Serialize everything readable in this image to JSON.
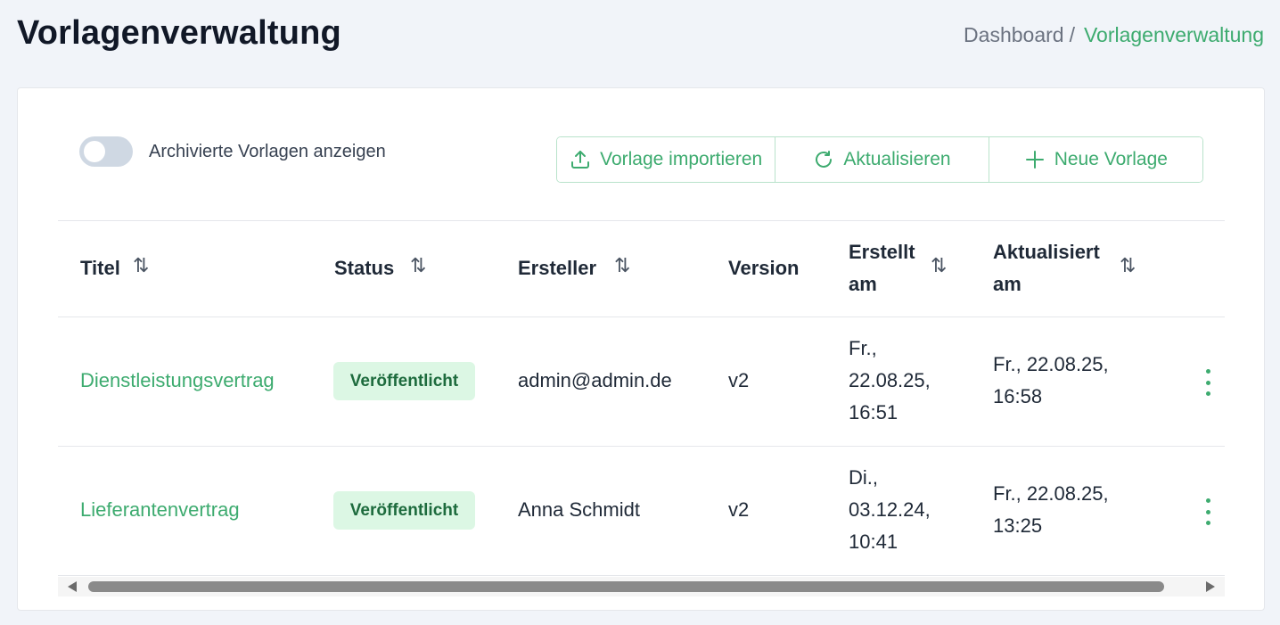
{
  "header": {
    "title": "Vorlagenverwaltung",
    "breadcrumb": [
      {
        "label": "Dashboard"
      },
      {
        "label": "Vorlagenverwaltung"
      }
    ],
    "breadcrumb_separator": "/"
  },
  "toolbar": {
    "archived_toggle": {
      "label": "Archivierte Vorlagen anzeigen",
      "checked": false
    },
    "import_label": "Vorlage importieren",
    "refresh_label": "Aktualisieren",
    "new_label": "Neue Vorlage"
  },
  "table": {
    "columns": {
      "title": "Titel",
      "status": "Status",
      "creator": "Ersteller",
      "version": "Version",
      "created_line1": "Erstellt",
      "created_line2": "am",
      "updated_line1": "Aktualisiert",
      "updated_line2": "am"
    },
    "rows": [
      {
        "title": "Dienstleistungsvertrag",
        "status": "Veröffentlicht",
        "creator": "admin@admin.de",
        "version": "v2",
        "created_line1": "Fr.,",
        "created_line2": "22.08.25,",
        "created_line3": "16:51",
        "updated_line1": "Fr., 22.08.25,",
        "updated_line2": "16:58"
      },
      {
        "title": "Lieferantenvertrag",
        "status": "Veröffentlicht",
        "creator": "Anna Schmidt",
        "version": "v2",
        "created_line1": "Di.,",
        "created_line2": "03.12.24,",
        "created_line3": "10:41",
        "updated_line1": "Fr., 22.08.25,",
        "updated_line2": "13:25"
      }
    ]
  },
  "colors": {
    "accent": "#3dab6f",
    "badge_bg": "#dcf7e4",
    "badge_text": "#1d6b3d",
    "page_bg": "#f1f4f9"
  },
  "icons": {
    "import": "upload-icon",
    "refresh": "refresh-icon",
    "new": "plus-icon",
    "sort": "sort-icon",
    "row_menu": "more-vertical-icon"
  }
}
